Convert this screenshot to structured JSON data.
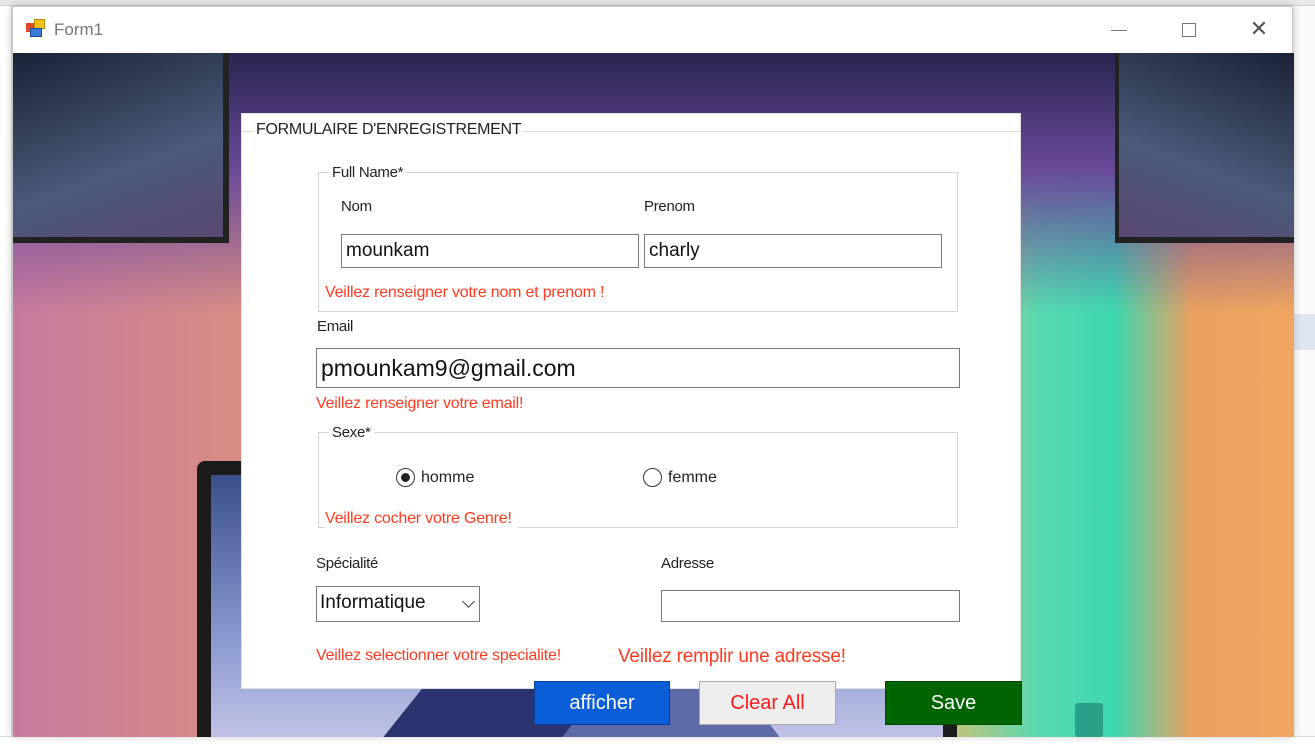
{
  "window": {
    "title": "Form1",
    "controls": {
      "minimize": "minimize",
      "maximize": "maximize",
      "close": "✕"
    }
  },
  "form": {
    "group_title": "FORMULAIRE D'ENREGISTREMENT",
    "full_name": {
      "legend": "Full Name*",
      "nom_label": "Nom",
      "nom_value": "mounkam",
      "prenom_label": "Prenom",
      "prenom_value": "charly",
      "error": "Veillez renseigner votre nom et prenom !"
    },
    "email": {
      "label": "Email",
      "value": "pmounkam9@gmail.com",
      "error": "Veillez renseigner votre email!"
    },
    "sexe": {
      "legend": "Sexe*",
      "options": [
        {
          "label": "homme",
          "checked": true
        },
        {
          "label": "femme",
          "checked": false
        }
      ],
      "error": "Veillez cocher votre Genre!"
    },
    "specialite": {
      "label": "Spécialité",
      "selected": "Informatique",
      "error": "Veillez selectionner votre specialite!"
    },
    "adresse": {
      "label": "Adresse",
      "value": "",
      "error": "Veillez remplir une adresse!"
    }
  },
  "buttons": {
    "afficher": "afficher",
    "clear_all": "Clear All",
    "save": "Save"
  },
  "colors": {
    "error": "#ff3b1f",
    "afficher_bg": "#0b5ed7",
    "save_bg": "#006400",
    "clear_text": "#ff1a1a"
  }
}
